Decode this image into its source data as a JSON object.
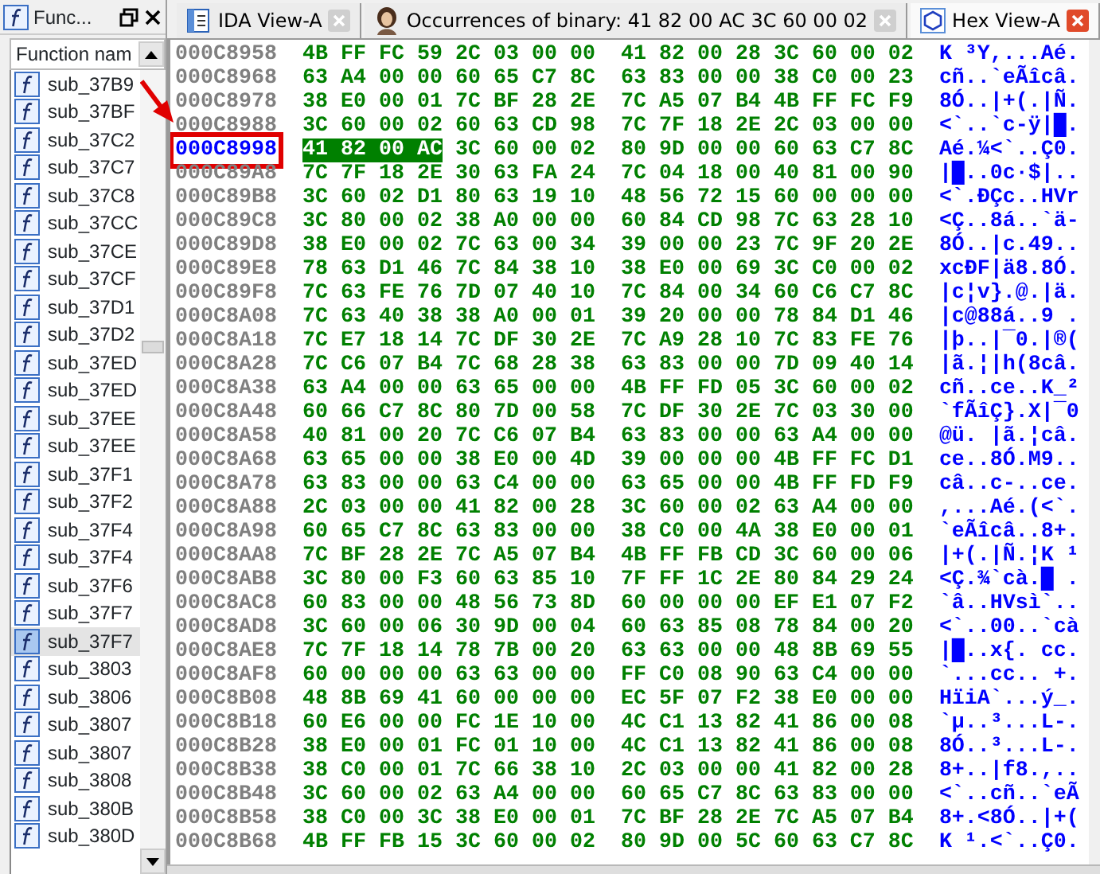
{
  "functions_panel": {
    "title": "Func...",
    "header": "Function nam",
    "items": [
      {
        "name": "sub_37B9",
        "selected": false
      },
      {
        "name": "sub_37BF",
        "selected": false
      },
      {
        "name": "sub_37C2",
        "selected": false
      },
      {
        "name": "sub_37C7",
        "selected": false
      },
      {
        "name": "sub_37C8",
        "selected": false
      },
      {
        "name": "sub_37CC",
        "selected": false
      },
      {
        "name": "sub_37CE",
        "selected": false
      },
      {
        "name": "sub_37CF",
        "selected": false
      },
      {
        "name": "sub_37D1",
        "selected": false
      },
      {
        "name": "sub_37D2",
        "selected": false
      },
      {
        "name": "sub_37ED",
        "selected": false
      },
      {
        "name": "sub_37ED",
        "selected": false
      },
      {
        "name": "sub_37EE",
        "selected": false
      },
      {
        "name": "sub_37EE",
        "selected": false
      },
      {
        "name": "sub_37F1",
        "selected": false
      },
      {
        "name": "sub_37F2",
        "selected": false
      },
      {
        "name": "sub_37F4",
        "selected": false
      },
      {
        "name": "sub_37F4",
        "selected": false
      },
      {
        "name": "sub_37F6",
        "selected": false
      },
      {
        "name": "sub_37F7",
        "selected": false
      },
      {
        "name": "sub_37F7",
        "selected": true
      },
      {
        "name": "sub_3803",
        "selected": false
      },
      {
        "name": "sub_3806",
        "selected": false
      },
      {
        "name": "sub_3807",
        "selected": false
      },
      {
        "name": "sub_3807",
        "selected": false
      },
      {
        "name": "sub_3808",
        "selected": false
      },
      {
        "name": "sub_380B",
        "selected": false
      },
      {
        "name": "sub_380D",
        "selected": false
      }
    ]
  },
  "tabs": [
    {
      "label": "IDA View-A",
      "kind": "disasm",
      "selected": false
    },
    {
      "label": "Occurrences of binary: 41 82 00 AC 3C 60 00 02",
      "kind": "search",
      "selected": false
    },
    {
      "label": "Hex View-A",
      "kind": "hex",
      "selected": true
    }
  ],
  "hex_rows": [
    {
      "address": "000C8958",
      "hex_left": "4B FF FC 59 2C 03 00 00",
      "hex_right": "41 82 00 28 3C 60 00 02",
      "ascii": "K ³Y,...Aé.",
      "selected": false
    },
    {
      "address": "000C8968",
      "hex_left": "63 A4 00 00 60 65 C7 8C",
      "hex_right": "63 83 00 00 38 C0 00 23",
      "ascii": "cñ..`eÃîcâ.",
      "selected": false
    },
    {
      "address": "000C8978",
      "hex_left": "38 E0 00 01 7C BF 28 2E",
      "hex_right": "7C A5 07 B4 4B FF FC F9",
      "ascii": "8Ó..|+(.|Ñ.",
      "selected": false
    },
    {
      "address": "000C8988",
      "hex_left": "3C 60 00 02 60 63 CD 98",
      "hex_right": "7C 7F 18 2E 2C 03 00 00",
      "ascii": "<`..`c-ÿ|█.",
      "selected": false
    },
    {
      "address": "000C8998",
      "match": "41 82 00 AC",
      "hex_left": "3C 60 00 02",
      "hex_right": "80 9D 00 00 60 63 C7 8C",
      "ascii": "Aé.¼<`..Ç0.",
      "selected": true
    },
    {
      "address": "000C89A8",
      "hex_left": "7C 7F 18 2E 30 63 FA 24",
      "hex_right": "7C 04 18 00 40 81 00 90",
      "ascii": "|█..0c·$|..",
      "selected": false
    },
    {
      "address": "000C89B8",
      "hex_left": "3C 60 02 D1 80 63 19 10",
      "hex_right": "48 56 72 15 60 00 00 00",
      "ascii": "<`.ÐÇc..HVr",
      "selected": false
    },
    {
      "address": "000C89C8",
      "hex_left": "3C 80 00 02 38 A0 00 00",
      "hex_right": "60 84 CD 98 7C 63 28 10",
      "ascii": "<Ç..8á..`ä-",
      "selected": false
    },
    {
      "address": "000C89D8",
      "hex_left": "38 E0 00 02 7C 63 00 34",
      "hex_right": "39 00 00 23 7C 9F 20 2E",
      "ascii": "8Ó..|c.49..",
      "selected": false
    },
    {
      "address": "000C89E8",
      "hex_left": "78 63 D1 46 7C 84 38 10",
      "hex_right": "38 E0 00 69 3C C0 00 02",
      "ascii": "xcÐF|ä8.8Ó.",
      "selected": false
    },
    {
      "address": "000C89F8",
      "hex_left": "7C 63 FE 76 7D 07 40 10",
      "hex_right": "7C 84 00 34 60 C6 C7 8C",
      "ascii": "|c¦v}.@.|ä.",
      "selected": false
    },
    {
      "address": "000C8A08",
      "hex_left": "7C 63 40 38 38 A0 00 01",
      "hex_right": "39 20 00 00 78 84 D1 46",
      "ascii": "|c@88á..9 .",
      "selected": false
    },
    {
      "address": "000C8A18",
      "hex_left": "7C E7 18 14 7C DF 30 2E",
      "hex_right": "7C A9 28 10 7C 83 FE 76",
      "ascii": "|þ..|¯0.|®(",
      "selected": false
    },
    {
      "address": "000C8A28",
      "hex_left": "7C C6 07 B4 7C 68 28 38",
      "hex_right": "63 83 00 00 7D 09 40 14",
      "ascii": "|ã.¦|h(8câ.",
      "selected": false
    },
    {
      "address": "000C8A38",
      "hex_left": "63 A4 00 00 63 65 00 00",
      "hex_right": "4B FF FD 05 3C 60 00 02",
      "ascii": "cñ..ce..K_²",
      "selected": false
    },
    {
      "address": "000C8A48",
      "hex_left": "60 66 C7 8C 80 7D 00 58",
      "hex_right": "7C DF 30 2E 7C 03 30 00",
      "ascii": "`fÃîÇ}.X|¯0",
      "selected": false
    },
    {
      "address": "000C8A58",
      "hex_left": "40 81 00 20 7C C6 07 B4",
      "hex_right": "63 83 00 00 63 A4 00 00",
      "ascii": "@ü. |ã.¦câ.",
      "selected": false
    },
    {
      "address": "000C8A68",
      "hex_left": "63 65 00 00 38 E0 00 4D",
      "hex_right": "39 00 00 00 4B FF FC D1",
      "ascii": "ce..8Ó.M9..",
      "selected": false
    },
    {
      "address": "000C8A78",
      "hex_left": "63 83 00 00 63 C4 00 00",
      "hex_right": "63 65 00 00 4B FF FD F9",
      "ascii": "câ..c-..ce.",
      "selected": false
    },
    {
      "address": "000C8A88",
      "hex_left": "2C 03 00 00 41 82 00 28",
      "hex_right": "3C 60 00 02 63 A4 00 00",
      "ascii": ",...Aé.(<`.",
      "selected": false
    },
    {
      "address": "000C8A98",
      "hex_left": "60 65 C7 8C 63 83 00 00",
      "hex_right": "38 C0 00 4A 38 E0 00 01",
      "ascii": "`eÃîcâ..8+.",
      "selected": false
    },
    {
      "address": "000C8AA8",
      "hex_left": "7C BF 28 2E 7C A5 07 B4",
      "hex_right": "4B FF FB CD 3C 60 00 06",
      "ascii": "|+(.|Ñ.¦K ¹",
      "selected": false
    },
    {
      "address": "000C8AB8",
      "hex_left": "3C 80 00 F3 60 63 85 10",
      "hex_right": "7F FF 1C 2E 80 84 29 24",
      "ascii": "<Ç.¾`cà.█ .",
      "selected": false
    },
    {
      "address": "000C8AC8",
      "hex_left": "60 83 00 00 48 56 73 8D",
      "hex_right": "60 00 00 00 EF E1 07 F2",
      "ascii": "`â..HVsì`..",
      "selected": false
    },
    {
      "address": "000C8AD8",
      "hex_left": "3C 60 00 06 30 9D 00 04",
      "hex_right": "60 63 85 08 78 84 00 20",
      "ascii": "<`..00..`cà",
      "selected": false
    },
    {
      "address": "000C8AE8",
      "hex_left": "7C 7F 18 14 78 7B 00 20",
      "hex_right": "63 63 00 00 48 8B 69 55",
      "ascii": "|█..x{. cc.",
      "selected": false
    },
    {
      "address": "000C8AF8",
      "hex_left": "60 00 00 00 63 63 00 00",
      "hex_right": "FF C0 08 90 63 C4 00 00",
      "ascii": "`...cc.. +.",
      "selected": false
    },
    {
      "address": "000C8B08",
      "hex_left": "48 8B 69 41 60 00 00 00",
      "hex_right": "EC 5F 07 F2 38 E0 00 00",
      "ascii": "HïiA`...ý_.",
      "selected": false
    },
    {
      "address": "000C8B18",
      "hex_left": "60 E6 00 00 FC 1E 10 00",
      "hex_right": "4C C1 13 82 41 86 00 08",
      "ascii": "`µ..³...L-.",
      "selected": false
    },
    {
      "address": "000C8B28",
      "hex_left": "38 E0 00 01 FC 01 10 00",
      "hex_right": "4C C1 13 82 41 86 00 08",
      "ascii": "8Ó..³...L-.",
      "selected": false
    },
    {
      "address": "000C8B38",
      "hex_left": "38 C0 00 01 7C 66 38 10",
      "hex_right": "2C 03 00 00 41 82 00 28",
      "ascii": "8+..|f8.,..",
      "selected": false
    },
    {
      "address": "000C8B48",
      "hex_left": "3C 60 00 02 63 A4 00 00",
      "hex_right": "60 65 C7 8C 63 83 00 00",
      "ascii": "<`..cñ..`eÃ",
      "selected": false
    },
    {
      "address": "000C8B58",
      "hex_left": "38 C0 00 3C 38 E0 00 01",
      "hex_right": "7C BF 28 2E 7C A5 07 B4",
      "ascii": "8+.<8Ó..|+(",
      "selected": false
    },
    {
      "address": "000C8B68",
      "hex_left": "4B FF FB 15 3C 60 00 02",
      "hex_right": "80 9D 00 5C 60 63 C7 8C",
      "ascii": "K ¹.<`..Ç0.",
      "selected": false
    }
  ]
}
